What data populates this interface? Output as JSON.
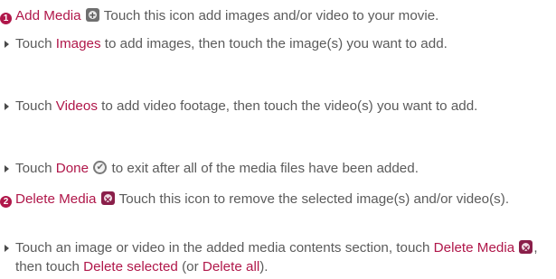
{
  "colors": {
    "highlight": "#b0174a",
    "text": "#5b5b5b"
  },
  "item1": {
    "number": "1",
    "title": "Add Media",
    "icon": "add-media-icon",
    "desc": " Touch this icon add images and/or video to your movie.",
    "bullets": [
      {
        "pre": "Touch ",
        "kw": "Images",
        "post": " to add images, then touch the image(s) you want to add."
      },
      {
        "pre": "Touch ",
        "kw": "Videos",
        "post": " to add video footage, then touch the video(s) you want to add."
      },
      {
        "pre": "Touch ",
        "kw": "Done",
        "icon": "done-check-icon",
        "post": " to exit after all of the media files have been added."
      }
    ]
  },
  "item2": {
    "number": "2",
    "title": "Delete Media",
    "icon": "delete-media-icon",
    "desc": " Touch this icon to remove the selected image(s) and/or video(s).",
    "bullet": {
      "pre": "Touch an image or video in the added media contents section, touch ",
      "kw1": "Delete Media",
      "mid": ", then touch ",
      "kw2": "Delete selected",
      "mid2": " (or ",
      "kw3": "Delete all",
      "post": ")."
    }
  }
}
